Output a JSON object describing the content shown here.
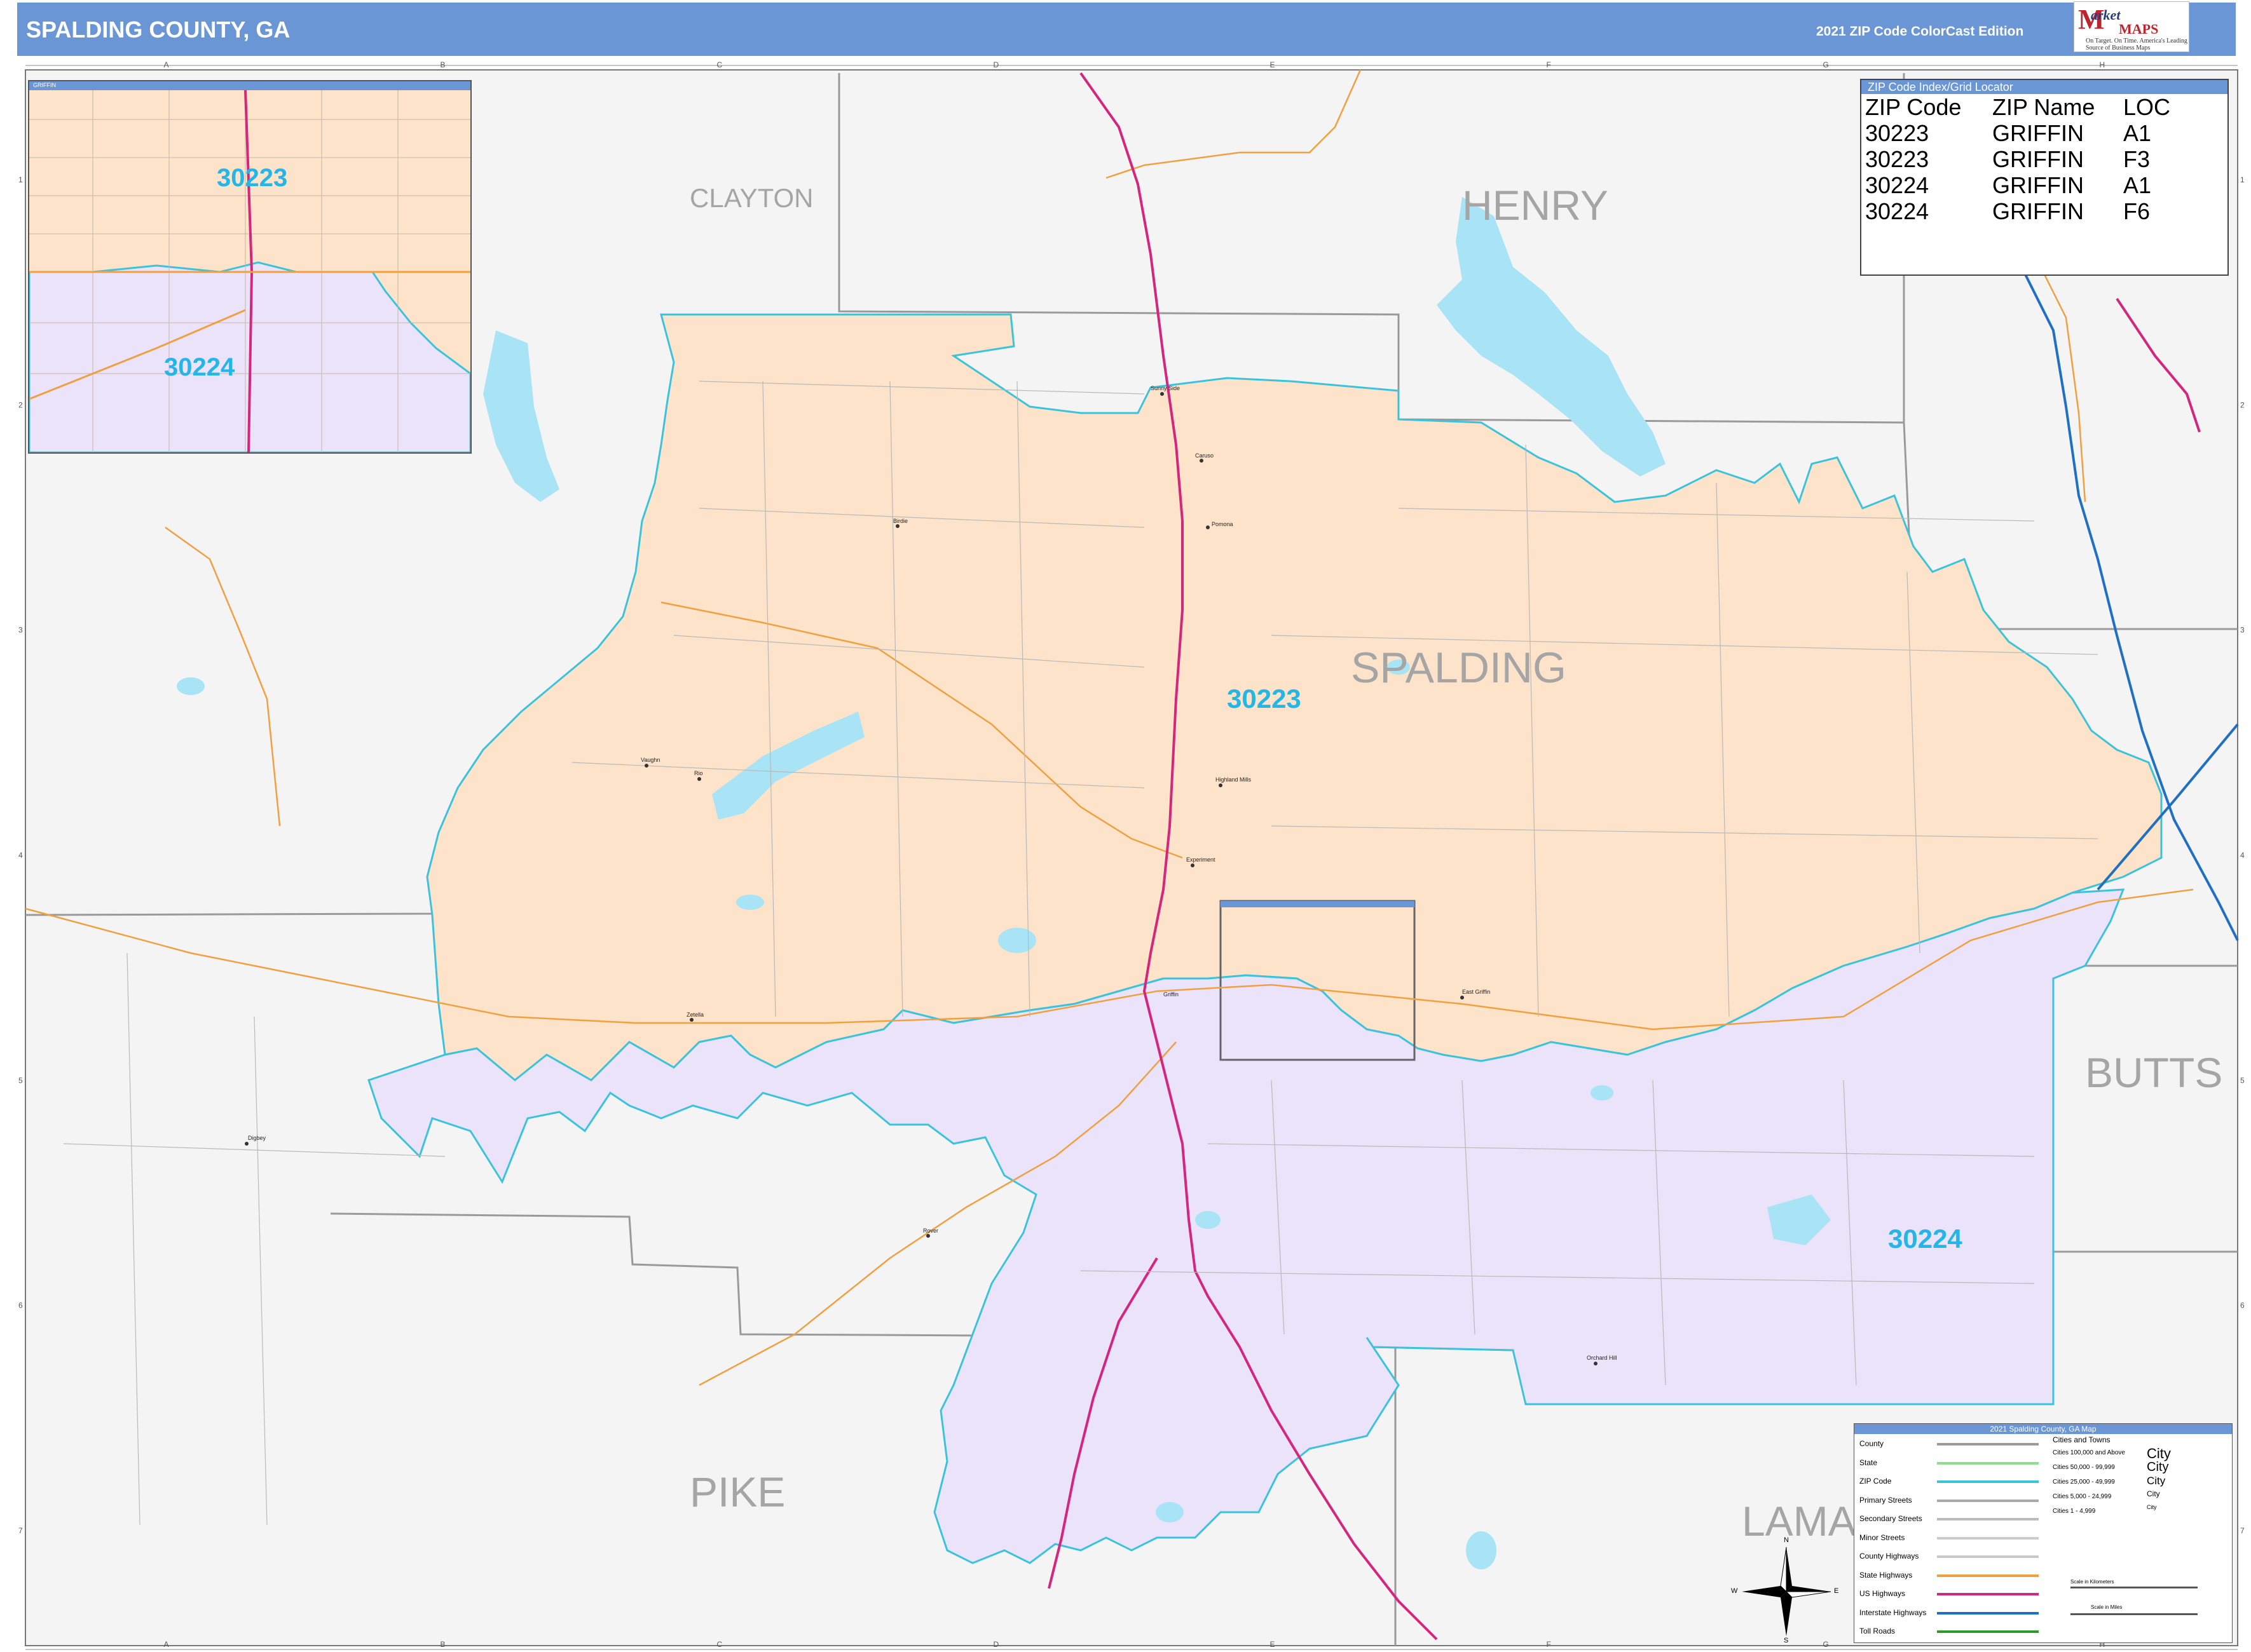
{
  "header": {
    "title": "SPALDING COUNTY, GA",
    "edition": "2021 ZIP Code ColorCast Edition",
    "logo_brand": "arket",
    "logo_brand_m": "M",
    "logo_maps": "MAPS",
    "logo_tagline": "On Target. On Time. America's Leading Source of Business Maps"
  },
  "grid": {
    "columns": [
      "A",
      "B",
      "C",
      "D",
      "E",
      "F",
      "G",
      "H"
    ],
    "rows": [
      "1",
      "2",
      "3",
      "4",
      "5",
      "6",
      "7"
    ]
  },
  "counties": {
    "clayton": "CLAYTON",
    "henry": "HENRY",
    "spalding": "SPALDING",
    "butts": "BUTTS",
    "pike": "PIKE",
    "lamar": "LAMA"
  },
  "zips": {
    "z1": "30223",
    "z2": "30224"
  },
  "places": [
    "Sunny Side",
    "Caruso",
    "Pomona",
    "Birdie",
    "Highland Mills",
    "Vaughn",
    "Rio",
    "Experiment",
    "Zetella",
    "Digbey",
    "Rover",
    "Orchard Hill",
    "East Griffin",
    "Griffin"
  ],
  "inset": {
    "label": "GRIFFIN",
    "zip_north": "30223",
    "zip_south": "30224"
  },
  "zip_index": {
    "title": "ZIP Code Index/Grid Locator",
    "headers": [
      "ZIP Code",
      "ZIP Name",
      "LOC"
    ],
    "rows": [
      [
        "30223",
        "GRIFFIN",
        "A1"
      ],
      [
        "30223",
        "GRIFFIN",
        "F3"
      ],
      [
        "30224",
        "GRIFFIN",
        "A1"
      ],
      [
        "30224",
        "GRIFFIN",
        "F6"
      ]
    ]
  },
  "legend": {
    "title": "2021 Spalding County, GA Map",
    "items": [
      "County",
      "State",
      "ZIP Code",
      "Primary Streets",
      "Secondary Streets",
      "Minor Streets",
      "County Highways",
      "State Highways",
      "US Highways",
      "Interstate Highways",
      "Toll Roads"
    ],
    "cities_title": "Cities and Towns",
    "city_sizes": [
      "Cities 100,000 and Above",
      "Cities 50,000 - 99,999",
      "Cities 25,000 - 49,999",
      "Cities 5,000 - 24,999",
      "Cities 1 - 4,999"
    ],
    "city_samples": [
      "City",
      "City",
      "City",
      "City",
      "City"
    ],
    "scale_km": "Scale in Kilometers",
    "scale_mi": "Scale in Miles"
  },
  "compass": {
    "n": "N",
    "s": "S",
    "e": "E",
    "w": "W"
  },
  "colors": {
    "header": "#6b96d6",
    "zip_30223": "#fde3c9",
    "zip_30224": "#ebe3fa",
    "zip_border": "#3cc3dc",
    "zip_label": "#23b6e6",
    "water": "#a8e4f6",
    "county_label": "#a5a5a5",
    "us_highway": "#d4267c",
    "state_highway": "#f0a040",
    "interstate": "#1f6fc5"
  }
}
